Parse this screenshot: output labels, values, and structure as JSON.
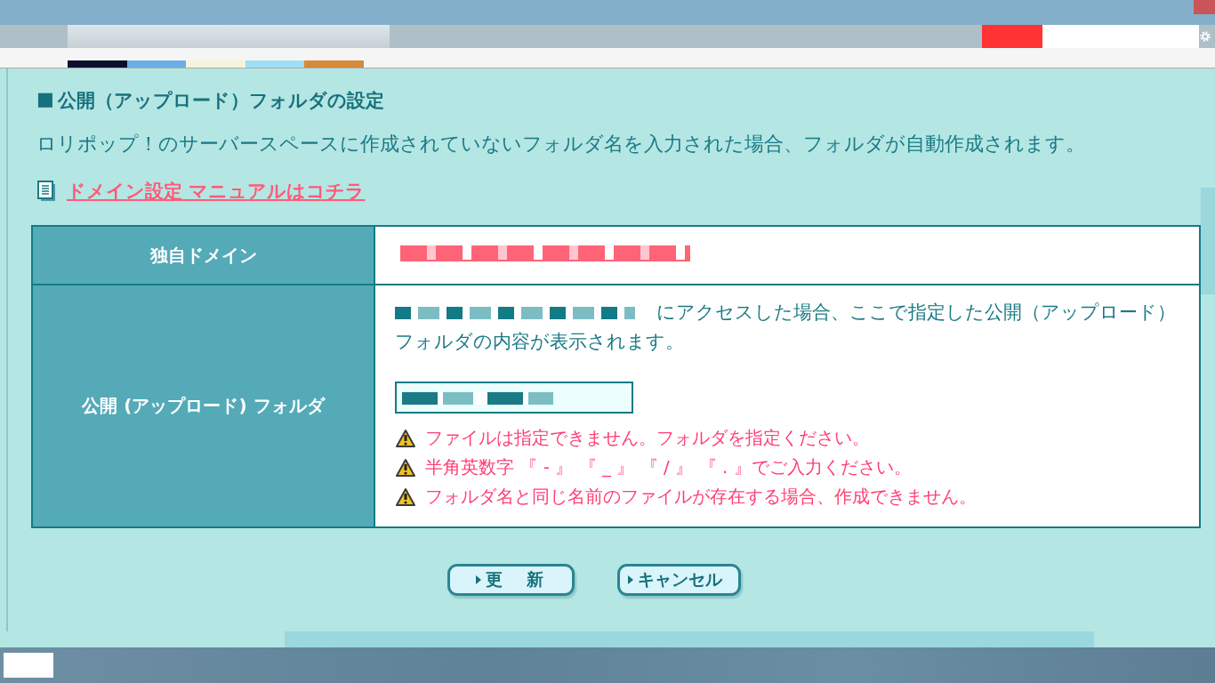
{
  "section": {
    "bullet": "■",
    "title": "公開（アップロード）フォルダの設定"
  },
  "description": "ロリポップ！のサーバースペースに作成されていないフォルダ名を入力された場合、フォルダが自動作成されます。",
  "manual_link": "ドメイン設定 マニュアルはコチラ",
  "table": {
    "rows": [
      {
        "kind": "domain",
        "label": "独自ドメイン"
      },
      {
        "kind": "folder",
        "label": "公開 (アップロード) フォルダ",
        "note_lines": [
          "にアクセスした場合、ここで指定した公開（アップロード）",
          "フォルダの内容が表示されます。"
        ],
        "warnings": [
          "ファイルは指定できません。フォルダを指定ください。",
          "半角英数字 『 - 』 『 _ 』 『 / 』 『 . 』でご入力ください。",
          "フォルダ名と同じ名前のファイルが存在する場合、作成できません。"
        ]
      }
    ]
  },
  "buttons": [
    {
      "kind": "submit",
      "label": "更　新"
    },
    {
      "kind": "cancel",
      "label": "キャンセル"
    }
  ]
}
